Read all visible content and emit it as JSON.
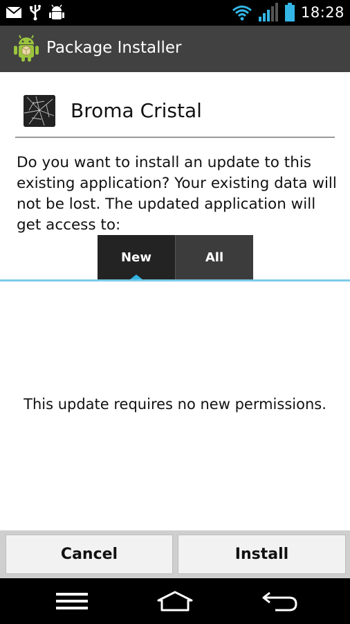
{
  "status_bar": {
    "time": "18:28",
    "icons": [
      "mail-icon",
      "usb-icon",
      "android-debug-icon",
      "wifi-icon",
      "signal-icon",
      "battery-icon"
    ]
  },
  "action_bar": {
    "title": "Package Installer",
    "icon": "android-package-icon",
    "background_color": "#414141"
  },
  "app": {
    "name": "Broma Cristal",
    "icon": "cracked-glass-icon"
  },
  "message": "Do you want to install an update to this existing application? Your existing data will not be lost.  The updated application will get access to:",
  "tabs": [
    {
      "label": "New",
      "selected": true
    },
    {
      "label": "All",
      "selected": false
    }
  ],
  "permissions_text": "This update requires no new permissions.",
  "buttons": {
    "cancel_label": "Cancel",
    "install_label": "Install"
  },
  "nav_bar": {
    "icons": [
      "menu-icon",
      "home-icon",
      "back-icon"
    ]
  },
  "colors": {
    "accent": "#33b5e5"
  }
}
